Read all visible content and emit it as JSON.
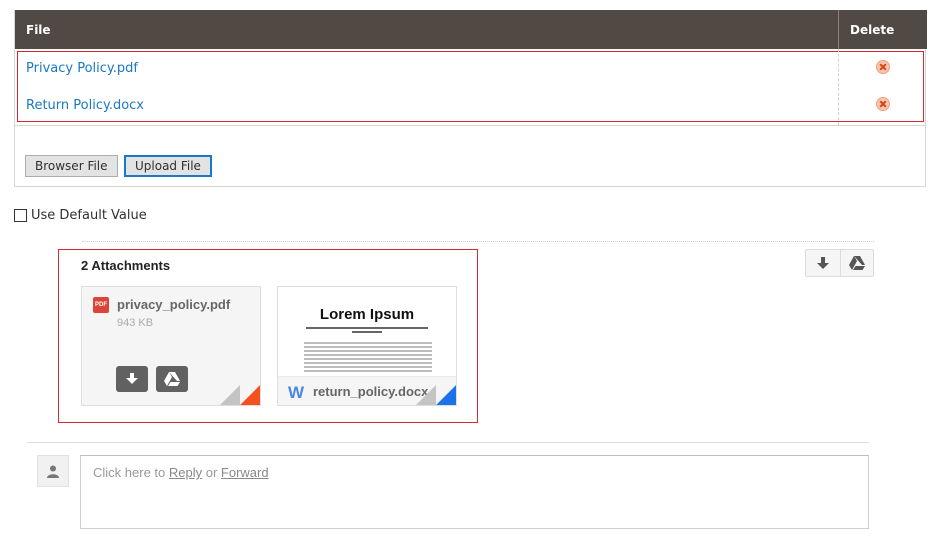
{
  "file_table": {
    "header_file": "File",
    "header_delete": "Delete",
    "rows": [
      {
        "name": "Privacy Policy.pdf"
      },
      {
        "name": "Return Policy.docx"
      }
    ],
    "browse_label": "Browser File",
    "upload_label": "Upload File"
  },
  "use_default": {
    "label": "Use Default Value",
    "checked": false
  },
  "attachments": {
    "title": "2 Attachments",
    "items": [
      {
        "name": "privacy_policy.pdf",
        "size": "943 KB",
        "type_badge": "PDF",
        "accent": "#f4511e"
      },
      {
        "name": "return_policy.docx",
        "type_badge": "W",
        "accent": "#1a73e8",
        "preview_heading": "Lorem Ipsum"
      }
    ],
    "header_actions": [
      "download-all-icon",
      "save-to-drive-icon"
    ]
  },
  "reply": {
    "prefix": "Click here to ",
    "reply_link": "Reply",
    "middle": " or ",
    "forward_link": "Forward"
  },
  "colors": {
    "table_header": "#514943",
    "link": "#1979c3",
    "highlight_border": "#d7262f",
    "delete_icon": "#d3431c"
  }
}
